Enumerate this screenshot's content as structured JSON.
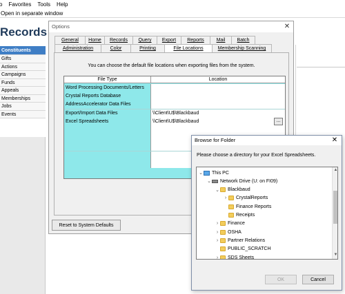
{
  "menu": [
    "o",
    "Favorites",
    "Tools",
    "Help"
  ],
  "open_separate": "Open in separate window",
  "app_title": "Records",
  "nav": [
    "Constituents",
    "Gifts",
    "Actions",
    "Campaigns",
    "Funds",
    "Appeals",
    "Memberships",
    "Jobs",
    "Events"
  ],
  "options": {
    "title": "Options",
    "tabs_row1": [
      "General",
      "Home",
      "Records",
      "Query",
      "Export",
      "Reports",
      "Mail",
      "Batch"
    ],
    "tabs_row2": [
      "Administration",
      "Color",
      "Printing",
      "File Locations",
      "Membership Scanning"
    ],
    "selected_tab": "File Locations",
    "description": "You can choose the default file locations when exporting files from the system.",
    "grid": {
      "headers": [
        "File Type",
        "Location"
      ],
      "rows": [
        {
          "type": "Word Processing Documents/Letters",
          "location": ""
        },
        {
          "type": "Crystal Reports Database",
          "location": ""
        },
        {
          "type": "AddressAccelerator Data Files",
          "location": ""
        },
        {
          "type": "Export/Import Data Files",
          "location": "\\\\Client\\U$\\Blackbaud"
        },
        {
          "type": "Excel Spreadsheets",
          "location": "\\\\Client\\U$\\Blackbaud"
        },
        {
          "type": "",
          "location": ""
        },
        {
          "type": "",
          "location": ""
        },
        {
          "type": "",
          "location": ""
        },
        {
          "type": "",
          "location": ""
        },
        {
          "type": "",
          "location": ""
        }
      ],
      "browse_label": "..."
    },
    "reset_label": "Reset to System Defaults",
    "close_glyph": "✕"
  },
  "browse_dialog": {
    "title": "Browse for Folder",
    "prompt": "Please choose a directory for your Excel Spreadsheets.",
    "tree": [
      {
        "label": "This PC",
        "level": 0,
        "expander": "expanded",
        "icon": "pc-icon"
      },
      {
        "label": "Network Drive (U: on FI09)",
        "level": 1,
        "expander": "expanded",
        "icon": "network-drive-icon"
      },
      {
        "label": "Blackbaud",
        "level": 2,
        "expander": "expanded",
        "icon": "folder-icon"
      },
      {
        "label": "CrystalReports",
        "level": 3,
        "expander": "collapsed",
        "icon": "folder-icon"
      },
      {
        "label": "Finance Reports",
        "level": 3,
        "expander": "none",
        "icon": "folder-icon"
      },
      {
        "label": "Receipts",
        "level": 3,
        "expander": "none",
        "icon": "folder-icon"
      },
      {
        "label": "Finance",
        "level": 2,
        "expander": "collapsed",
        "icon": "folder-icon"
      },
      {
        "label": "OSHA",
        "level": 2,
        "expander": "collapsed",
        "icon": "folder-icon"
      },
      {
        "label": "Partner Relations",
        "level": 2,
        "expander": "collapsed",
        "icon": "folder-icon"
      },
      {
        "label": "PUBLIC_SCRATCH",
        "level": 2,
        "expander": "none",
        "icon": "folder-icon"
      },
      {
        "label": "SDS Sheets",
        "level": 2,
        "expander": "collapsed",
        "icon": "folder-icon"
      }
    ],
    "ok_label": "OK",
    "cancel_label": "Cancel",
    "close_glyph": "✕"
  },
  "colors": {
    "nav_active": "#3f7ec5",
    "grid_cyan": "#8ee8ea",
    "title_blue": "#1f3a5a"
  }
}
